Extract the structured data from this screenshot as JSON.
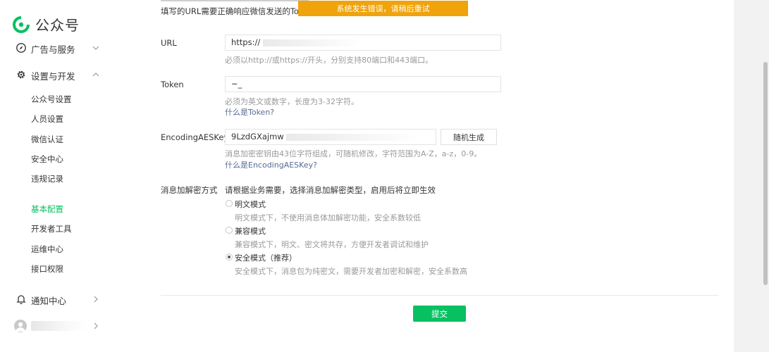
{
  "sidebar": {
    "brand": "公众号",
    "groups": {
      "ads": {
        "label": "广告与服务"
      },
      "dev": {
        "label": "设置与开发"
      },
      "notify": {
        "label": "通知中心"
      }
    },
    "items": [
      "公众号设置",
      "人员设置",
      "微信认证",
      "安全中心",
      "违规记录",
      "基本配置",
      "开发者工具",
      "运维中心",
      "接口权限"
    ],
    "active_item": "基本配置"
  },
  "toast": "系统发生错误，请稍后重试",
  "intro": "填写的URL需要正确响应微信发送的Token验",
  "form": {
    "url": {
      "label": "URL",
      "value": "https://",
      "tip": "必须以http://或https://开头，分别支持80端口和443端口。"
    },
    "token": {
      "label": "Token",
      "value": "~_",
      "tip": "必须为英文或数字，长度为3-32字符。",
      "link": "什么是Token?"
    },
    "aes": {
      "label": "EncodingAESKey",
      "value": "9LzdGXajmw",
      "tip": "消息加密密钥由43位字符组成，可随机修改，字符范围为A-Z，a-z，0-9。",
      "link": "什么是EncodingAESKey?",
      "generate_label": "随机生成"
    },
    "mode": {
      "label": "消息加解密方式",
      "desc": "请根据业务需要，选择消息加解密类型，启用后将立即生效",
      "options": [
        {
          "label": "明文模式",
          "sub": "明文模式下，不使用消息体加解密功能，安全系数较低"
        },
        {
          "label": "兼容模式",
          "sub": "兼容模式下，明文、密文将共存，方便开发者调试和维护"
        },
        {
          "label": "安全模式（推荐）",
          "sub": "安全模式下，消息包为纯密文，需要开发者加密和解密，安全系数高"
        }
      ],
      "selected": "安全模式（推荐）"
    },
    "submit_label": "提交"
  },
  "colors": {
    "accent": "#07c160",
    "toast": "#f0a30a",
    "link": "#576b95"
  }
}
